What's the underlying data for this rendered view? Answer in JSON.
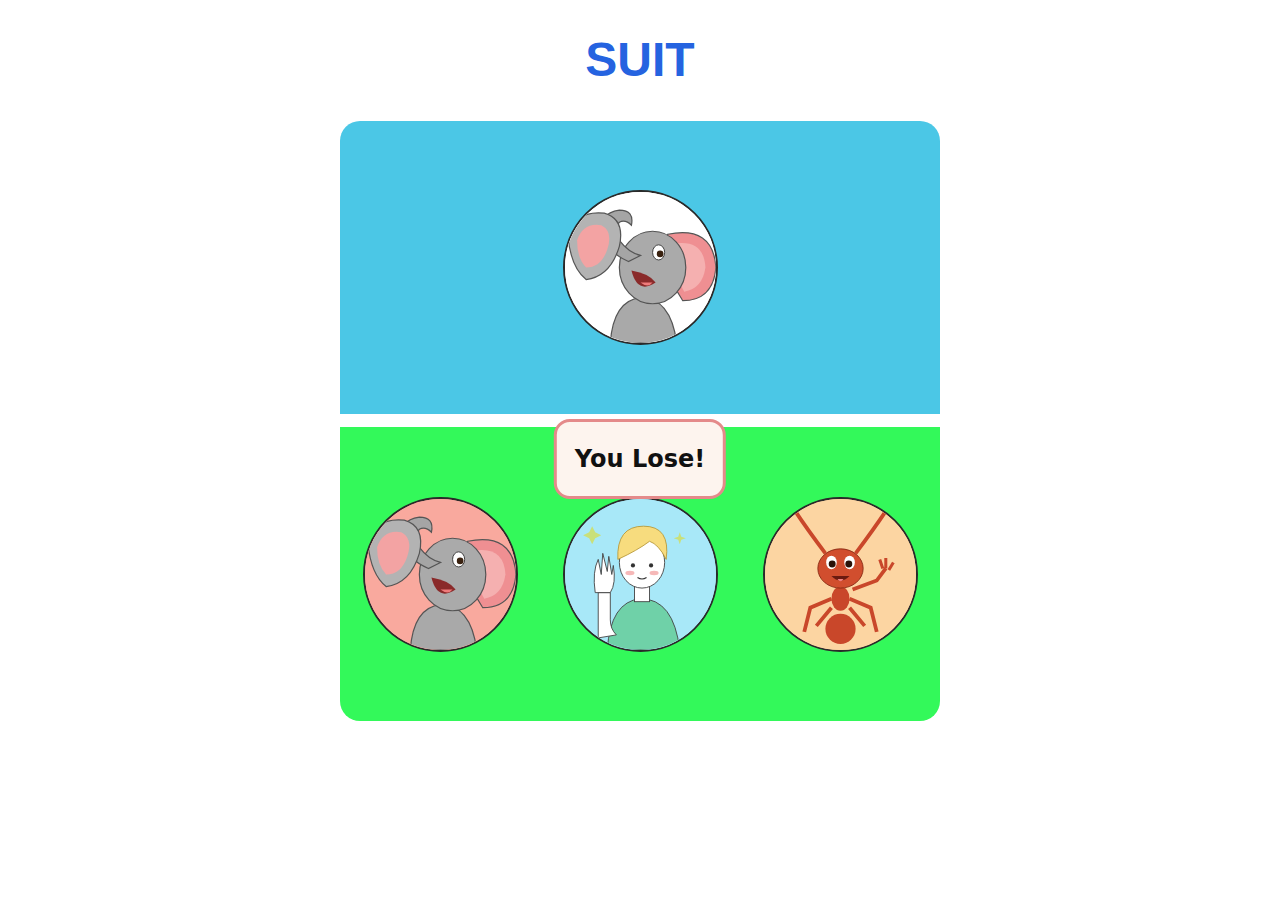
{
  "title": "SUIT",
  "computer_choice": {
    "kind": "elephant",
    "color": "#ffffff"
  },
  "player_choices": [
    {
      "kind": "elephant",
      "color": "#f9a99e"
    },
    {
      "kind": "human",
      "color": "#a8e8f8"
    },
    {
      "kind": "ant",
      "color": "#fcd5a2"
    }
  ],
  "result": "You Lose!"
}
